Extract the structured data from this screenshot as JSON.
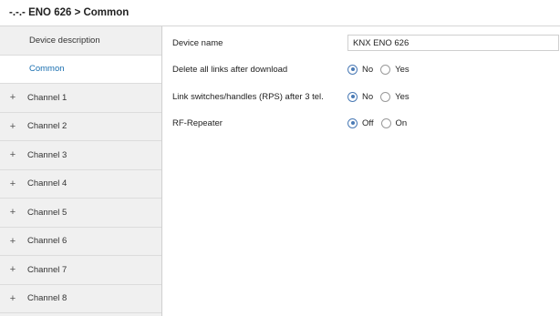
{
  "breadcrumb": "-.-.- ENO 626 > Common",
  "sidebar": {
    "items": [
      {
        "label": "Device description",
        "expandable": false,
        "active": false
      },
      {
        "label": "Common",
        "expandable": false,
        "active": true
      },
      {
        "label": "Channel 1",
        "expandable": true,
        "active": false
      },
      {
        "label": "Channel 2",
        "expandable": true,
        "active": false
      },
      {
        "label": "Channel 3",
        "expandable": true,
        "active": false
      },
      {
        "label": "Channel 4",
        "expandable": true,
        "active": false
      },
      {
        "label": "Channel 5",
        "expandable": true,
        "active": false
      },
      {
        "label": "Channel 6",
        "expandable": true,
        "active": false
      },
      {
        "label": "Channel 7",
        "expandable": true,
        "active": false
      },
      {
        "label": "Channel 8",
        "expandable": true,
        "active": false
      }
    ],
    "expand_glyph": "+"
  },
  "params": {
    "device_name": {
      "label": "Device name",
      "value": "KNX ENO 626"
    },
    "delete_links": {
      "label": "Delete all links after download",
      "options": [
        "No",
        "Yes"
      ],
      "selected": "No"
    },
    "link_switches": {
      "label": "Link switches/handles (RPS) after 3 tel.",
      "options": [
        "No",
        "Yes"
      ],
      "selected": "No"
    },
    "rf_repeater": {
      "label": "RF-Repeater",
      "options": [
        "Off",
        "On"
      ],
      "selected": "Off"
    }
  },
  "colors": {
    "accent": "#1a6fb0",
    "radio_selected": "#4a7ab5",
    "sidebar_bg": "#f0f0f0"
  }
}
